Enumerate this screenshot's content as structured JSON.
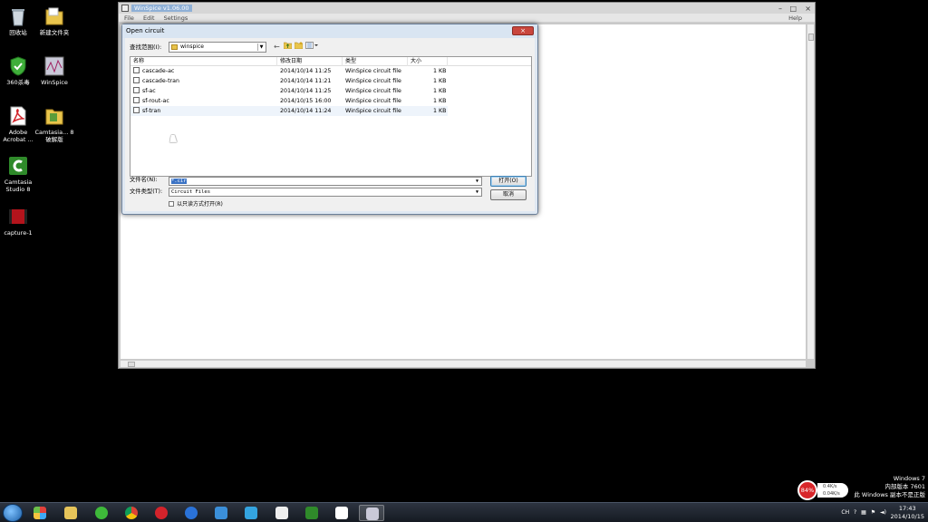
{
  "desktop": {
    "icons": [
      {
        "label": "回收站"
      },
      {
        "label": "新建文件夹"
      },
      {
        "label": "360杀毒"
      },
      {
        "label": "WinSpice"
      },
      {
        "label": "Adobe Acrobat ..."
      },
      {
        "label": "Camtasia... 8破解版"
      },
      {
        "label": "Camtasia Studio 8"
      },
      {
        "label": "capture-1"
      }
    ]
  },
  "main_window": {
    "title": "WinSpice v1.06.00",
    "menu": {
      "file": "File",
      "edit": "Edit",
      "settings": "Settings",
      "help": "Help"
    },
    "controls": {
      "minimize": "–",
      "maximize": "□",
      "close": "×"
    }
  },
  "dialog": {
    "title": "Open circuit",
    "close": "×",
    "look_in_label": "查找范围(I):",
    "look_in_value": "winspice",
    "columns": {
      "name": "名称",
      "date": "修改日期",
      "type": "类型",
      "size": "大小"
    },
    "files": [
      {
        "name": "cascade-ac",
        "date": "2014/10/14 11:25",
        "type": "WinSpice circuit file",
        "size": "1 KB"
      },
      {
        "name": "cascade-tran",
        "date": "2014/10/14 11:21",
        "type": "WinSpice circuit file",
        "size": "1 KB"
      },
      {
        "name": "sf-ac",
        "date": "2014/10/14 11:25",
        "type": "WinSpice circuit file",
        "size": "1 KB"
      },
      {
        "name": "sf-rout-ac",
        "date": "2014/10/15 16:00",
        "type": "WinSpice circuit file",
        "size": "1 KB"
      },
      {
        "name": "sf-tran",
        "date": "2014/10/14 11:24",
        "type": "WinSpice circuit file",
        "size": "1 KB"
      }
    ],
    "filename_label": "文件名(N):",
    "filename_value": "*.cir",
    "filetype_label": "文件类型(T):",
    "filetype_value": "Circuit Files",
    "readonly_label": "以只读方式打开(R)",
    "open_button": "打开(O)",
    "cancel_button": "取消"
  },
  "watermark": {
    "line1": "Windows 7",
    "line2": "内部版本 7601",
    "line3": "此 Windows 副本不是正版"
  },
  "network_widget": {
    "percent": "84%",
    "up": "0.4K/s",
    "down": "0.04K/s"
  },
  "tray": {
    "lang": "CH"
  },
  "clock": {
    "time": "17:43",
    "date": "2014/10/15"
  }
}
